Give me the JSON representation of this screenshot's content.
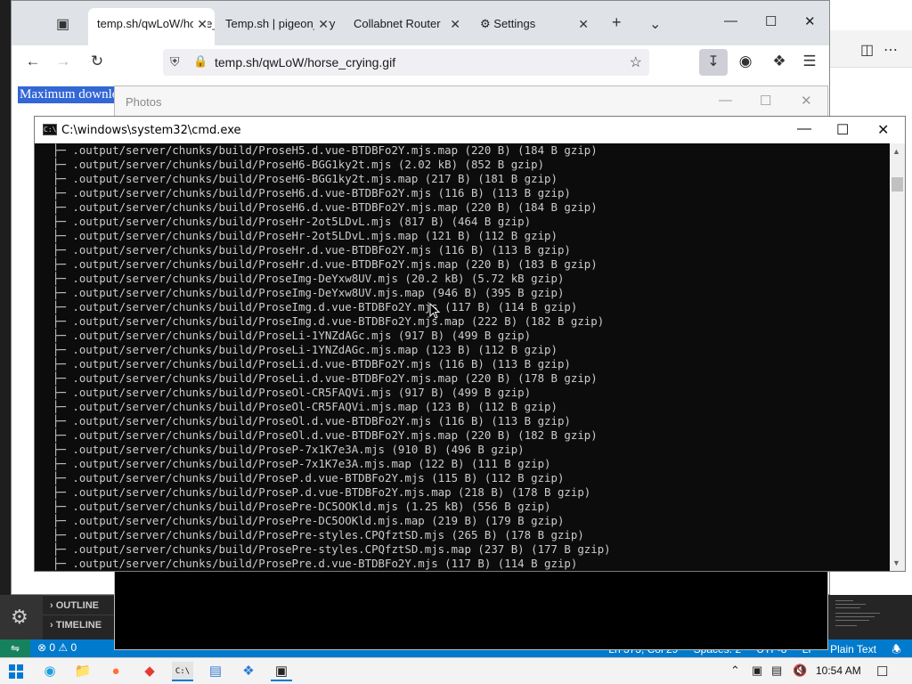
{
  "browser": {
    "tabs": [
      {
        "label": "temp.sh/qwLoW/horse_crying.gif",
        "active": true
      },
      {
        "label": "Temp.sh | pigeon_crying.gif",
        "active": false
      },
      {
        "label": "Collabnet Router",
        "active": false
      },
      {
        "label": "Settings",
        "active": false
      }
    ],
    "url": "temp.sh/qwLoW/horse_crying.gif",
    "page_text": "Maximum download"
  },
  "photos": {
    "title": "Photos"
  },
  "cmd": {
    "title": "C:\\windows\\system32\\cmd.exe",
    "icon_text": "C:\\",
    "lines": [
      "├─ .output/server/chunks/build/ProseH5.d.vue-BTDBFo2Y.mjs.map (220 B) (184 B gzip)",
      "├─ .output/server/chunks/build/ProseH6-BGG1ky2t.mjs (2.02 kB) (852 B gzip)",
      "├─ .output/server/chunks/build/ProseH6-BGG1ky2t.mjs.map (217 B) (181 B gzip)",
      "├─ .output/server/chunks/build/ProseH6.d.vue-BTDBFo2Y.mjs (116 B) (113 B gzip)",
      "├─ .output/server/chunks/build/ProseH6.d.vue-BTDBFo2Y.mjs.map (220 B) (184 B gzip)",
      "├─ .output/server/chunks/build/ProseHr-2ot5LDvL.mjs (817 B) (464 B gzip)",
      "├─ .output/server/chunks/build/ProseHr-2ot5LDvL.mjs.map (121 B) (112 B gzip)",
      "├─ .output/server/chunks/build/ProseHr.d.vue-BTDBFo2Y.mjs (116 B) (113 B gzip)",
      "├─ .output/server/chunks/build/ProseHr.d.vue-BTDBFo2Y.mjs.map (220 B) (183 B gzip)",
      "├─ .output/server/chunks/build/ProseImg-DeYxw8UV.mjs (20.2 kB) (5.72 kB gzip)",
      "├─ .output/server/chunks/build/ProseImg-DeYxw8UV.mjs.map (946 B) (395 B gzip)",
      "├─ .output/server/chunks/build/ProseImg.d.vue-BTDBFo2Y.mjs (117 B) (114 B gzip)",
      "├─ .output/server/chunks/build/ProseImg.d.vue-BTDBFo2Y.mjs.map (222 B) (182 B gzip)",
      "├─ .output/server/chunks/build/ProseLi-1YNZdAGc.mjs (917 B) (499 B gzip)",
      "├─ .output/server/chunks/build/ProseLi-1YNZdAGc.mjs.map (123 B) (112 B gzip)",
      "├─ .output/server/chunks/build/ProseLi.d.vue-BTDBFo2Y.mjs (116 B) (113 B gzip)",
      "├─ .output/server/chunks/build/ProseLi.d.vue-BTDBFo2Y.mjs.map (220 B) (178 B gzip)",
      "├─ .output/server/chunks/build/ProseOl-CR5FAQVi.mjs (917 B) (499 B gzip)",
      "├─ .output/server/chunks/build/ProseOl-CR5FAQVi.mjs.map (123 B) (112 B gzip)",
      "├─ .output/server/chunks/build/ProseOl.d.vue-BTDBFo2Y.mjs (116 B) (113 B gzip)",
      "├─ .output/server/chunks/build/ProseOl.d.vue-BTDBFo2Y.mjs.map (220 B) (182 B gzip)",
      "├─ .output/server/chunks/build/ProseP-7x1K7e3A.mjs (910 B) (496 B gzip)",
      "├─ .output/server/chunks/build/ProseP-7x1K7e3A.mjs.map (122 B) (111 B gzip)",
      "├─ .output/server/chunks/build/ProseP.d.vue-BTDBFo2Y.mjs (115 B) (112 B gzip)",
      "├─ .output/server/chunks/build/ProseP.d.vue-BTDBFo2Y.mjs.map (218 B) (178 B gzip)",
      "├─ .output/server/chunks/build/ProsePre-DC5OOKld.mjs (1.25 kB) (556 B gzip)",
      "├─ .output/server/chunks/build/ProsePre-DC5OOKld.mjs.map (219 B) (179 B gzip)",
      "├─ .output/server/chunks/build/ProsePre-styles.CPQfztSD.mjs (265 B) (178 B gzip)",
      "├─ .output/server/chunks/build/ProsePre-styles.CPQfztSD.mjs.map (237 B) (177 B gzip)",
      "├─ .output/server/chunks/build/ProsePre.d.vue-BTDBFo2Y.mjs (117 B) (114 B gzip)"
    ]
  },
  "vscode": {
    "sections": [
      "OUTLINE",
      "TIMELINE"
    ],
    "problems": "⊗ 0 ⚠ 0",
    "status_right": [
      "Ln 373, Col 29",
      "Spaces: 2",
      "UTF-8",
      "LF",
      "Plain Text"
    ]
  },
  "taskbar": {
    "time": "10:54 AM"
  },
  "colors": {
    "vscode_status": "#007acc",
    "cmd_bg": "#0c0c0c",
    "cmd_fg": "#cccccc",
    "selection": "#3367d6"
  }
}
